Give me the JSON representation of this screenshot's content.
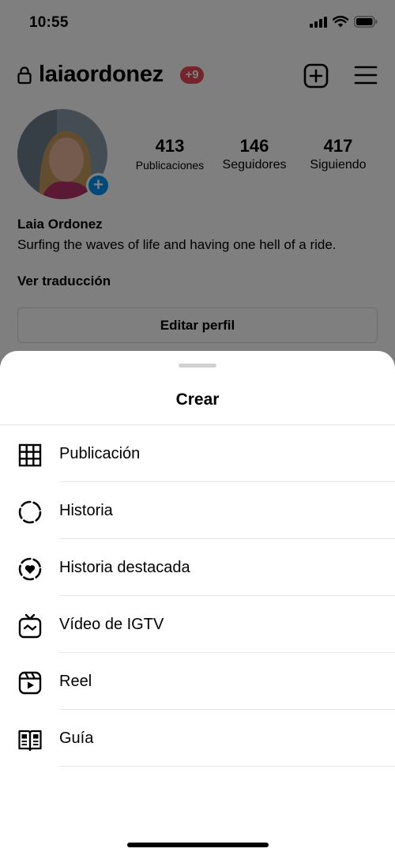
{
  "status_bar": {
    "time": "10:55"
  },
  "profile": {
    "username": "laiaordonez",
    "notification_badge": "+9",
    "stats": {
      "posts_count": "413",
      "posts_label": "Publicaciones",
      "followers_count": "146",
      "followers_label": "Seguidores",
      "following_count": "417",
      "following_label": "Siguiendo"
    },
    "bio": {
      "name": "Laia Ordonez",
      "text": "Surfing the waves of life and having one hell of a ride.",
      "translate_label": "Ver traducción"
    },
    "edit_profile_label": "Editar perfil"
  },
  "create_sheet": {
    "title": "Crear",
    "options": [
      {
        "label": "Publicación",
        "icon": "grid-icon"
      },
      {
        "label": "Historia",
        "icon": "story-dashed-circle-icon"
      },
      {
        "label": "Historia destacada",
        "icon": "highlight-heart-icon"
      },
      {
        "label": "Vídeo de IGTV",
        "icon": "igtv-icon"
      },
      {
        "label": "Reel",
        "icon": "reel-icon"
      },
      {
        "label": "Guía",
        "icon": "guide-book-icon"
      }
    ]
  },
  "colors": {
    "badge": "#ed4956",
    "accent_blue": "#0095f6",
    "overlay": "rgba(0,0,0,0.5)"
  }
}
